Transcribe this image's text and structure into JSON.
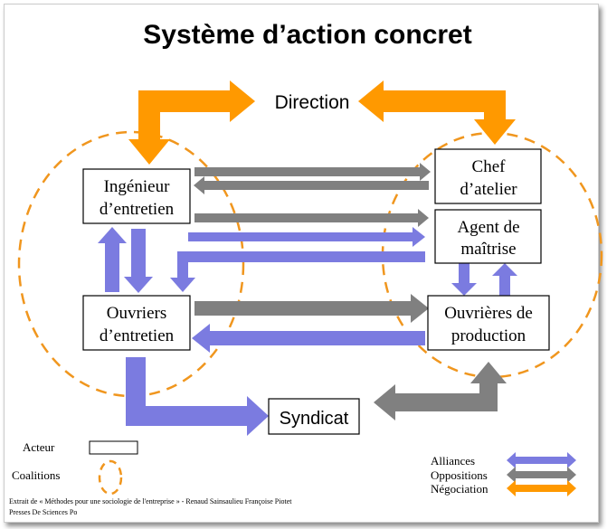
{
  "title": "Système d’action concret",
  "colors": {
    "alliance": "#7b7be0",
    "opposition": "#808080",
    "negotiation": "#ff9900",
    "coalition": "#f0961e"
  },
  "actors": {
    "direction": "Direction",
    "ingenieur": [
      "Ingénieur",
      "d’entretien"
    ],
    "ouvriers": [
      "Ouvriers",
      "d’entretien"
    ],
    "chef": [
      "Chef",
      "d’atelier"
    ],
    "agent": [
      "Agent de",
      "maîtrise"
    ],
    "ouvrieres": [
      "Ouvrières de",
      "production"
    ],
    "syndicat": "Syndicat"
  },
  "legend": {
    "acteur": "Acteur",
    "coalitions": "Coalitions",
    "alliances": "Alliances",
    "oppositions": "Oppositions",
    "negociation": "Négociation"
  },
  "footer": {
    "line1": "Extrait de « Méthodes pour une sociologie de l'entreprise » - Renaud Sainsaulieu Françoise Piotet",
    "line2": "Presses De Sciences Po"
  }
}
